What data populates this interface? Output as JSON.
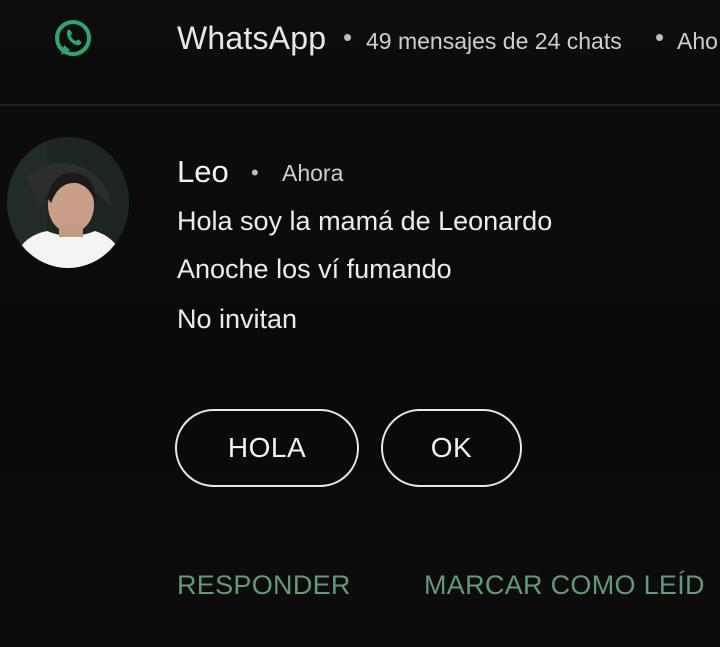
{
  "header": {
    "app_name": "WhatsApp",
    "separator": "•",
    "summary": "49 mensajes de 24 chats",
    "time": "Aho",
    "icon": "whatsapp-icon"
  },
  "message": {
    "sender": "Leo",
    "separator": "•",
    "time": "Ahora",
    "lines": [
      "Hola soy la mamá de Leonardo",
      "Anoche los ví fumando",
      "No invitan"
    ],
    "avatar": "avatar"
  },
  "quick_replies": [
    "HOLA",
    "OK"
  ],
  "actions": {
    "reply_label": "RESPONDER",
    "mark_read_label": "MARCAR COMO LEÍD"
  },
  "colors": {
    "background": "#0a0b0a",
    "accent_green": "#5f9a7a",
    "icon_green": "#2aa874",
    "text": "#ececec"
  }
}
